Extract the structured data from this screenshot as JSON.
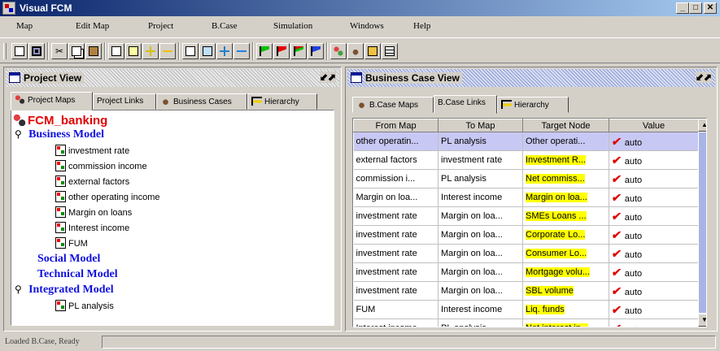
{
  "window": {
    "title": "Visual FCM",
    "controls": [
      "_",
      "□",
      "✕"
    ]
  },
  "menu": [
    "Map",
    "Edit Map",
    "Project",
    "B.Case",
    "Simulation",
    "Windows",
    "Help"
  ],
  "toolbar": {
    "icons": [
      "new-icon",
      "save-icon",
      "cut-icon",
      "copy-icon",
      "paste-icon",
      "new-node-icon",
      "edit-node-icon",
      "add-node-icon",
      "remove-node-icon",
      "new-map-icon",
      "edit-map-icon",
      "add-icon",
      "remove-icon",
      "green-flag-icon",
      "red-flag-icon",
      "red-green-flag-icon",
      "blue-flag-icon",
      "project-icon",
      "business-case-icon",
      "report-icon",
      "table-icon"
    ]
  },
  "project_view": {
    "title": "Project View",
    "window_controls": "⬋⬈",
    "tabs": [
      "Project Maps",
      "Project Links",
      "Business Cases",
      "Hierarchy"
    ],
    "active_tab": "Project Maps",
    "tree": {
      "root": "FCM_banking",
      "models": [
        {
          "name": "Business Model",
          "expanded": true,
          "maps": [
            "investment rate",
            "commission income",
            "external factors",
            "other operating income",
            "Margin on loans",
            "Interest income",
            "FUM"
          ]
        },
        {
          "name": "Social Model",
          "expanded": false,
          "maps": []
        },
        {
          "name": "Technical Model",
          "expanded": false,
          "maps": []
        },
        {
          "name": "Integrated Model",
          "expanded": true,
          "maps": [
            "PL analysis"
          ]
        }
      ]
    }
  },
  "business_case_view": {
    "title": "Business Case View",
    "window_controls": "⬋⬈",
    "tabs": [
      "B.Case Maps",
      "B.Case Links",
      "Hierarchy"
    ],
    "active_tab": "B.Case Links",
    "columns": [
      "From Map",
      "To Map",
      "Target Node",
      "Value"
    ],
    "rows": [
      {
        "from": "other operatin...",
        "to": "PL analysis",
        "target": "Other operati...",
        "highlight": false,
        "value": "auto",
        "selected": true
      },
      {
        "from": "external factors",
        "to": "investment rate",
        "target": "Investment R...",
        "highlight": true,
        "value": "auto",
        "selected": false
      },
      {
        "from": "commission i...",
        "to": "PL analysis",
        "target": "Net commiss...",
        "highlight": true,
        "value": "auto",
        "selected": false
      },
      {
        "from": "Margin on loa...",
        "to": "Interest income",
        "target": "Margin on loa...",
        "highlight": true,
        "value": "auto",
        "selected": false
      },
      {
        "from": "investment rate",
        "to": "Margin on loa...",
        "target": "SMEs Loans ...",
        "highlight": true,
        "value": "auto",
        "selected": false
      },
      {
        "from": "investment rate",
        "to": "Margin on loa...",
        "target": "Corporate Lo...",
        "highlight": true,
        "value": "auto",
        "selected": false
      },
      {
        "from": "investment rate",
        "to": "Margin on loa...",
        "target": "Consumer Lo...",
        "highlight": true,
        "value": "auto",
        "selected": false
      },
      {
        "from": "investment rate",
        "to": "Margin on loa...",
        "target": "Mortgage volu...",
        "highlight": true,
        "value": "auto",
        "selected": false
      },
      {
        "from": "investment rate",
        "to": "Margin on loa...",
        "target": "SBL volume",
        "highlight": true,
        "value": "auto",
        "selected": false
      },
      {
        "from": "FUM",
        "to": "Interest income",
        "target": "Liq. funds",
        "highlight": true,
        "value": "auto",
        "selected": false
      },
      {
        "from": "Interest income",
        "to": "PL analysis",
        "target": "Net interest in...",
        "highlight": true,
        "value": "auto",
        "selected": false
      }
    ]
  },
  "status": {
    "text": "Loaded B.Case, Ready"
  },
  "colors": {
    "title_bar": "#0a246a",
    "root_label": "#e00000",
    "model_label": "#1010e0",
    "highlight": "#ffff00",
    "selected_row": "#c8c8f4",
    "check": "#e00000"
  }
}
